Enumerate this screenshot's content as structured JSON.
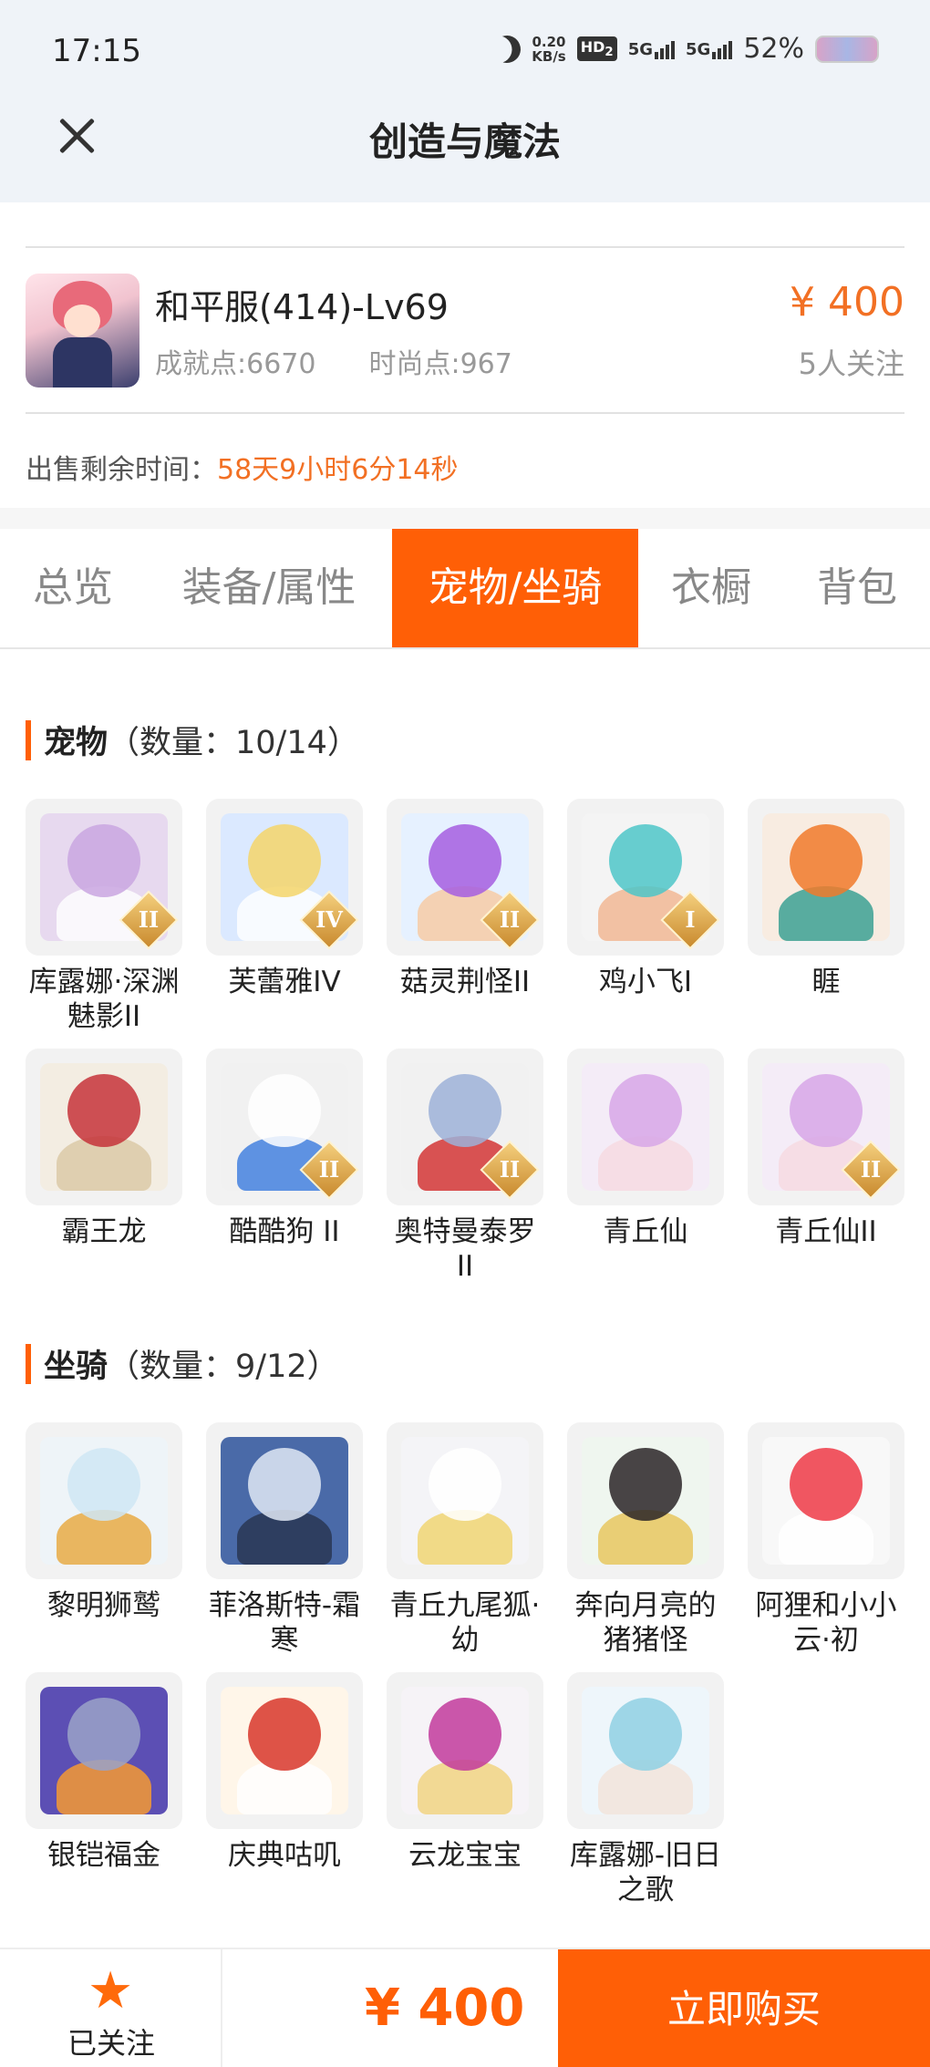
{
  "status_bar": {
    "time": "17:15",
    "net_speed": "0.20",
    "net_unit": "KB/s",
    "hd": "HD",
    "hd_sub": "2",
    "sig1": "5G",
    "sig2": "5G",
    "battery": "52%"
  },
  "header": {
    "title": "创造与魔法"
  },
  "product": {
    "name": "和平服(414)-Lv69",
    "achievement": "成就点:6670",
    "fashion": "时尚点:967",
    "price": "¥ 400",
    "followers": "5人关注",
    "remaining_label": "出售剩余时间：",
    "remaining_value": "58天9小时6分14秒"
  },
  "tabs": [
    {
      "label": "总览"
    },
    {
      "label": "装备/属性"
    },
    {
      "label": "宠物/坐骑",
      "active": true
    },
    {
      "label": "衣橱"
    },
    {
      "label": "背包"
    }
  ],
  "pets": {
    "title": "宠物",
    "count": "（数量：10/14）",
    "items": [
      {
        "name": "库露娜·深渊魅影II",
        "badge": "II",
        "colors": [
          "#e7d9ef",
          "#c9a6e0",
          "#ffffff"
        ]
      },
      {
        "name": "芙蕾雅IV",
        "badge": "IV",
        "colors": [
          "#dbe9ff",
          "#f5d56a",
          "#ffffff"
        ]
      },
      {
        "name": "菇灵荆怪II",
        "badge": "II",
        "colors": [
          "#e6f1ff",
          "#a45ee0",
          "#f7c9a0"
        ]
      },
      {
        "name": "鸡小飞I",
        "badge": "I",
        "colors": [
          "#f4f4f4",
          "#4ec6c8",
          "#f1b48e"
        ]
      },
      {
        "name": "睚",
        "badge": "",
        "colors": [
          "#f8ece1",
          "#f17a2a",
          "#2f9c8e"
        ]
      },
      {
        "name": "霸王龙",
        "badge": "",
        "colors": [
          "#f3ede2",
          "#c5333a",
          "#d9c7a4"
        ]
      },
      {
        "name": "酷酷狗 II",
        "badge": "II",
        "colors": [
          "#f1f1f1",
          "#ffffff",
          "#3a7bde"
        ]
      },
      {
        "name": "奥特曼泰罗II",
        "badge": "II",
        "colors": [
          "#f1f1f1",
          "#9db2d8",
          "#d22b2b"
        ]
      },
      {
        "name": "青丘仙",
        "badge": "",
        "colors": [
          "#f4ecf7",
          "#d7a7e8",
          "#f6d9e0"
        ]
      },
      {
        "name": "青丘仙II",
        "badge": "II",
        "colors": [
          "#f4ecf7",
          "#d7a7e8",
          "#f6d9e0"
        ]
      }
    ]
  },
  "mounts": {
    "title": "坐骑",
    "count": "（数量：9/12）",
    "items": [
      {
        "name": "黎明狮鹫",
        "badge": "",
        "colors": [
          "#eef4f8",
          "#cfe6f4",
          "#e7a63a"
        ]
      },
      {
        "name": "菲洛斯特-霜寒",
        "badge": "",
        "colors": [
          "#4a6aa8",
          "#dfe8f4",
          "#27334e"
        ]
      },
      {
        "name": "青丘九尾狐·幼",
        "badge": "",
        "colors": [
          "#f4f4f7",
          "#ffffff",
          "#f0d36a"
        ]
      },
      {
        "name": "奔向月亮的猪猪怪",
        "badge": "",
        "colors": [
          "#eff6ef",
          "#2a2527",
          "#e7c456"
        ]
      },
      {
        "name": "阿狸和小小云·初",
        "badge": "",
        "colors": [
          "#f8f8f8",
          "#ef3a47",
          "#ffffff"
        ]
      },
      {
        "name": "银铠福金",
        "badge": "",
        "colors": [
          "#5c4fb4",
          "#9aa2c8",
          "#ff9e2a"
        ]
      },
      {
        "name": "庆典咕叽",
        "badge": "",
        "colors": [
          "#fff6e9",
          "#d8362a",
          "#ffffff"
        ]
      },
      {
        "name": "云龙宝宝",
        "badge": "",
        "colors": [
          "#f6f3f7",
          "#c2399c",
          "#f1d27a"
        ]
      },
      {
        "name": "库露娜-旧日之歌",
        "badge": "",
        "colors": [
          "#eef6fb",
          "#8fd0e3",
          "#f3e4d9"
        ]
      }
    ]
  },
  "bottom_bar": {
    "follow_label": "已关注",
    "price": "¥ 400",
    "buy_label": "立即购买"
  }
}
